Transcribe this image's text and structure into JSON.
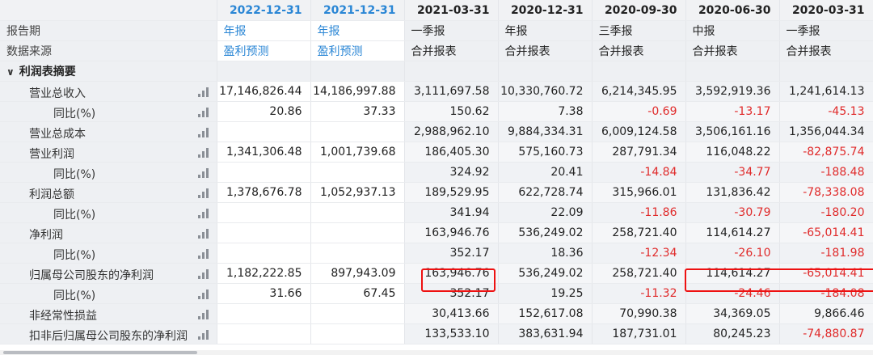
{
  "columns": [
    {
      "date": "2022-12-31",
      "type": "年报",
      "source": "盈利预测",
      "forecast": true
    },
    {
      "date": "2021-12-31",
      "type": "年报",
      "source": "盈利预测",
      "forecast": true
    },
    {
      "date": "2021-03-31",
      "type": "一季报",
      "source": "合并报表",
      "forecast": false
    },
    {
      "date": "2020-12-31",
      "type": "年报",
      "source": "合并报表",
      "forecast": false
    },
    {
      "date": "2020-09-30",
      "type": "三季报",
      "source": "合并报表",
      "forecast": false
    },
    {
      "date": "2020-06-30",
      "type": "中报",
      "source": "合并报表",
      "forecast": false
    },
    {
      "date": "2020-03-31",
      "type": "一季报",
      "source": "合并报表",
      "forecast": false
    }
  ],
  "meta_labels": {
    "report_period": "报告期",
    "data_source": "数据来源"
  },
  "section": {
    "chevron": "∨",
    "title": "利润表摘要"
  },
  "rows": [
    {
      "label": "营业总收入",
      "sub": false,
      "values": [
        "17,146,826.44",
        "14,186,997.88",
        "3,111,697.58",
        "10,330,760.72",
        "6,214,345.95",
        "3,592,919.36",
        "1,241,614.13"
      ]
    },
    {
      "label": "同比(%)",
      "sub": true,
      "values": [
        "20.86",
        "37.33",
        "150.62",
        "7.38",
        "-0.69",
        "-13.17",
        "-45.13"
      ]
    },
    {
      "label": "营业总成本",
      "sub": false,
      "values": [
        "",
        "",
        "2,988,962.10",
        "9,884,334.31",
        "6,009,124.58",
        "3,506,161.16",
        "1,356,044.34"
      ]
    },
    {
      "label": "营业利润",
      "sub": false,
      "values": [
        "1,341,306.48",
        "1,001,739.68",
        "186,405.30",
        "575,160.73",
        "287,791.34",
        "116,048.22",
        "-82,875.74"
      ]
    },
    {
      "label": "同比(%)",
      "sub": true,
      "values": [
        "",
        "",
        "324.92",
        "20.41",
        "-14.84",
        "-34.77",
        "-188.48"
      ]
    },
    {
      "label": "利润总额",
      "sub": false,
      "values": [
        "1,378,676.78",
        "1,052,937.13",
        "189,529.95",
        "622,728.74",
        "315,966.01",
        "131,836.42",
        "-78,338.08"
      ]
    },
    {
      "label": "同比(%)",
      "sub": true,
      "values": [
        "",
        "",
        "341.94",
        "22.09",
        "-11.86",
        "-30.79",
        "-180.20"
      ]
    },
    {
      "label": "净利润",
      "sub": false,
      "values": [
        "",
        "",
        "163,946.76",
        "536,249.02",
        "258,721.40",
        "114,614.27",
        "-65,014.41"
      ]
    },
    {
      "label": "同比(%)",
      "sub": true,
      "values": [
        "",
        "",
        "352.17",
        "18.36",
        "-12.34",
        "-26.10",
        "-181.98"
      ]
    },
    {
      "label": "归属母公司股东的净利润",
      "sub": false,
      "values": [
        "1,182,222.85",
        "897,943.09",
        "163,946.76",
        "536,249.02",
        "258,721.40",
        "114,614.27",
        "-65,014.41"
      ]
    },
    {
      "label": "同比(%)",
      "sub": true,
      "values": [
        "31.66",
        "67.45",
        "352.17",
        "19.25",
        "-11.32",
        "-24.46",
        "-184.08"
      ]
    },
    {
      "label": "非经常性损益",
      "sub": false,
      "values": [
        "",
        "",
        "30,413.66",
        "152,617.08",
        "70,990.38",
        "34,369.05",
        "9,866.46"
      ]
    },
    {
      "label": "扣非后归属母公司股东的净利润",
      "sub": false,
      "values": [
        "",
        "",
        "133,533.10",
        "383,631.94",
        "187,731.01",
        "80,245.23",
        "-74,880.87"
      ]
    }
  ],
  "colors": {
    "forecast_header": "#2a86d5",
    "negative": "#e02a2a",
    "highlight_box": "#e11111"
  }
}
